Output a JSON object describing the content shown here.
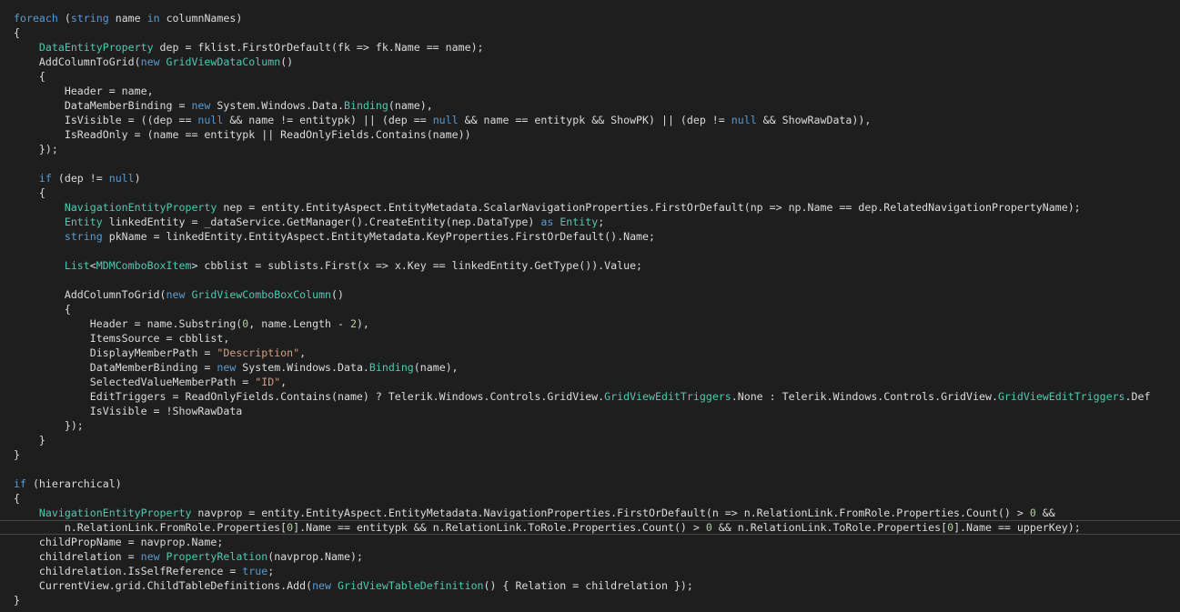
{
  "editor": {
    "colors": {
      "background": "#1e1e1e",
      "plain": "#dcdcdc",
      "keyword": "#569cd6",
      "type": "#4ec9b0",
      "string": "#d69d85",
      "number": "#b5cea8",
      "current_line_border": "#464646"
    },
    "current_line": 36,
    "lines": [
      [
        [
          "kw",
          "foreach"
        ],
        [
          "p",
          " ("
        ],
        [
          "kw",
          "string"
        ],
        [
          "p",
          " name "
        ],
        [
          "kw",
          "in"
        ],
        [
          "p",
          " columnNames)"
        ]
      ],
      [
        [
          "p",
          "{"
        ]
      ],
      [
        [
          "p",
          "    "
        ],
        [
          "type",
          "DataEntityProperty"
        ],
        [
          "p",
          " dep = fklist.FirstOrDefault(fk => fk.Name == name);"
        ]
      ],
      [
        [
          "p",
          "    AddColumnToGrid("
        ],
        [
          "kw",
          "new"
        ],
        [
          "p",
          " "
        ],
        [
          "type",
          "GridViewDataColumn"
        ],
        [
          "p",
          "()"
        ]
      ],
      [
        [
          "p",
          "    {"
        ]
      ],
      [
        [
          "p",
          "        Header = name,"
        ]
      ],
      [
        [
          "p",
          "        DataMemberBinding = "
        ],
        [
          "kw",
          "new"
        ],
        [
          "p",
          " System.Windows.Data."
        ],
        [
          "type",
          "Binding"
        ],
        [
          "p",
          "(name),"
        ]
      ],
      [
        [
          "p",
          "        IsVisible = ((dep == "
        ],
        [
          "kw",
          "null"
        ],
        [
          "p",
          " && name != entitypk) || (dep == "
        ],
        [
          "kw",
          "null"
        ],
        [
          "p",
          " && name == entitypk && ShowPK) || (dep != "
        ],
        [
          "kw",
          "null"
        ],
        [
          "p",
          " && ShowRawData)),"
        ]
      ],
      [
        [
          "p",
          "        IsReadOnly = (name == entitypk || ReadOnlyFields.Contains(name))"
        ]
      ],
      [
        [
          "p",
          "    });"
        ]
      ],
      [],
      [
        [
          "p",
          "    "
        ],
        [
          "kw",
          "if"
        ],
        [
          "p",
          " (dep != "
        ],
        [
          "kw",
          "null"
        ],
        [
          "p",
          ")"
        ]
      ],
      [
        [
          "p",
          "    {"
        ]
      ],
      [
        [
          "p",
          "        "
        ],
        [
          "type",
          "NavigationEntityProperty"
        ],
        [
          "p",
          " nep = entity.EntityAspect.EntityMetadata.ScalarNavigationProperties.FirstOrDefault(np => np.Name == dep.RelatedNavigationPropertyName);"
        ]
      ],
      [
        [
          "p",
          "        "
        ],
        [
          "type",
          "Entity"
        ],
        [
          "p",
          " linkedEntity = _dataService.GetManager().CreateEntity(nep.DataType) "
        ],
        [
          "kw",
          "as"
        ],
        [
          "p",
          " "
        ],
        [
          "type",
          "Entity"
        ],
        [
          "p",
          ";"
        ]
      ],
      [
        [
          "p",
          "        "
        ],
        [
          "kw",
          "string"
        ],
        [
          "p",
          " pkName = linkedEntity.EntityAspect.EntityMetadata.KeyProperties.FirstOrDefault().Name;"
        ]
      ],
      [],
      [
        [
          "p",
          "        "
        ],
        [
          "type",
          "List"
        ],
        [
          "p",
          "<"
        ],
        [
          "type",
          "MDMComboBoxItem"
        ],
        [
          "p",
          "> cbblist = sublists.First(x => x.Key == linkedEntity.GetType()).Value;"
        ]
      ],
      [],
      [
        [
          "p",
          "        AddColumnToGrid("
        ],
        [
          "kw",
          "new"
        ],
        [
          "p",
          " "
        ],
        [
          "type",
          "GridViewComboBoxColumn"
        ],
        [
          "p",
          "()"
        ]
      ],
      [
        [
          "p",
          "        {"
        ]
      ],
      [
        [
          "p",
          "            Header = name.Substring("
        ],
        [
          "num",
          "0"
        ],
        [
          "p",
          ", name.Length - "
        ],
        [
          "num",
          "2"
        ],
        [
          "p",
          "),"
        ]
      ],
      [
        [
          "p",
          "            ItemsSource = cbblist,"
        ]
      ],
      [
        [
          "p",
          "            DisplayMemberPath = "
        ],
        [
          "str",
          "\"Description\""
        ],
        [
          "p",
          ","
        ]
      ],
      [
        [
          "p",
          "            DataMemberBinding = "
        ],
        [
          "kw",
          "new"
        ],
        [
          "p",
          " System.Windows.Data."
        ],
        [
          "type",
          "Binding"
        ],
        [
          "p",
          "(name),"
        ]
      ],
      [
        [
          "p",
          "            SelectedValueMemberPath = "
        ],
        [
          "str",
          "\"ID\""
        ],
        [
          "p",
          ","
        ]
      ],
      [
        [
          "p",
          "            EditTriggers = ReadOnlyFields.Contains(name) ? Telerik.Windows.Controls.GridView."
        ],
        [
          "type",
          "GridViewEditTriggers"
        ],
        [
          "p",
          ".None : Telerik.Windows.Controls.GridView."
        ],
        [
          "type",
          "GridViewEditTriggers"
        ],
        [
          "p",
          ".Def"
        ]
      ],
      [
        [
          "p",
          "            IsVisible = !ShowRawData"
        ]
      ],
      [
        [
          "p",
          "        });"
        ]
      ],
      [
        [
          "p",
          "    }"
        ]
      ],
      [
        [
          "p",
          "}"
        ]
      ],
      [],
      [
        [
          "kw",
          "if"
        ],
        [
          "p",
          " (hierarchical)"
        ]
      ],
      [
        [
          "p",
          "{"
        ]
      ],
      [
        [
          "p",
          "    "
        ],
        [
          "type",
          "NavigationEntityProperty"
        ],
        [
          "p",
          " navprop = entity.EntityAspect.EntityMetadata.NavigationProperties.FirstOrDefault(n => n.RelationLink.FromRole.Properties.Count() > "
        ],
        [
          "num",
          "0"
        ],
        [
          "p",
          " &&"
        ]
      ],
      [
        [
          "p",
          "        n.RelationLink.FromRole.Properties["
        ],
        [
          "num",
          "0"
        ],
        [
          "p",
          "].Name == entitypk && n.RelationLink.ToRole.Properties.Count() > "
        ],
        [
          "num",
          "0"
        ],
        [
          "p",
          " && n.RelationLink.ToRole.Properties["
        ],
        [
          "num",
          "0"
        ],
        [
          "p",
          "].Name == upperKey);"
        ]
      ],
      [
        [
          "p",
          "    childPropName = navprop.Name;"
        ]
      ],
      [
        [
          "p",
          "    childrelation = "
        ],
        [
          "kw",
          "new"
        ],
        [
          "p",
          " "
        ],
        [
          "type",
          "PropertyRelation"
        ],
        [
          "p",
          "(navprop.Name);"
        ]
      ],
      [
        [
          "p",
          "    childrelation.IsSelfReference = "
        ],
        [
          "kw",
          "true"
        ],
        [
          "p",
          ";"
        ]
      ],
      [
        [
          "p",
          "    CurrentView.grid.ChildTableDefinitions.Add("
        ],
        [
          "kw",
          "new"
        ],
        [
          "p",
          " "
        ],
        [
          "type",
          "GridViewTableDefinition"
        ],
        [
          "p",
          "() { Relation = childrelation });"
        ]
      ],
      [
        [
          "p",
          "}"
        ]
      ]
    ]
  }
}
